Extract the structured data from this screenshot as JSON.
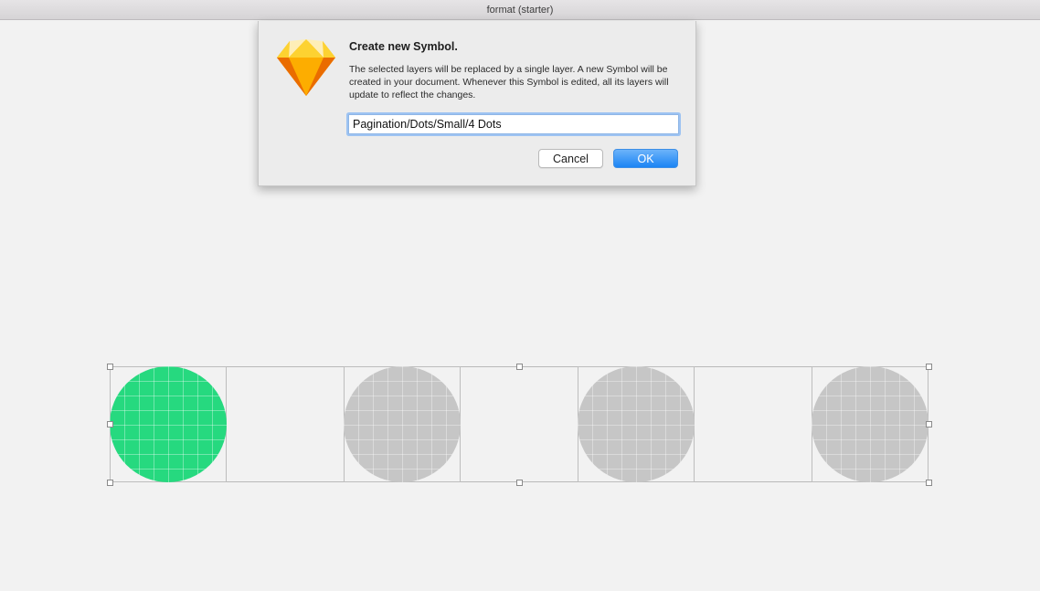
{
  "window": {
    "title": "format (starter)"
  },
  "dialog": {
    "title": "Create new Symbol.",
    "message": "The selected layers will be replaced by a single layer. A new Symbol will be created in your document. Whenever this Symbol is edited, all its layers will update to reflect the changes.",
    "input_value": "Pagination/Dots/Small/4 Dots",
    "cancel_label": "Cancel",
    "ok_label": "OK",
    "icon": "sketch-diamond-icon"
  },
  "canvas": {
    "dots": [
      {
        "name": "dot-1",
        "color": "#26d97f",
        "active": true
      },
      {
        "name": "dot-2",
        "color": "#c6c6c6",
        "active": false
      },
      {
        "name": "dot-3",
        "color": "#c6c6c6",
        "active": false
      },
      {
        "name": "dot-4",
        "color": "#c6c6c6",
        "active": false
      }
    ]
  }
}
